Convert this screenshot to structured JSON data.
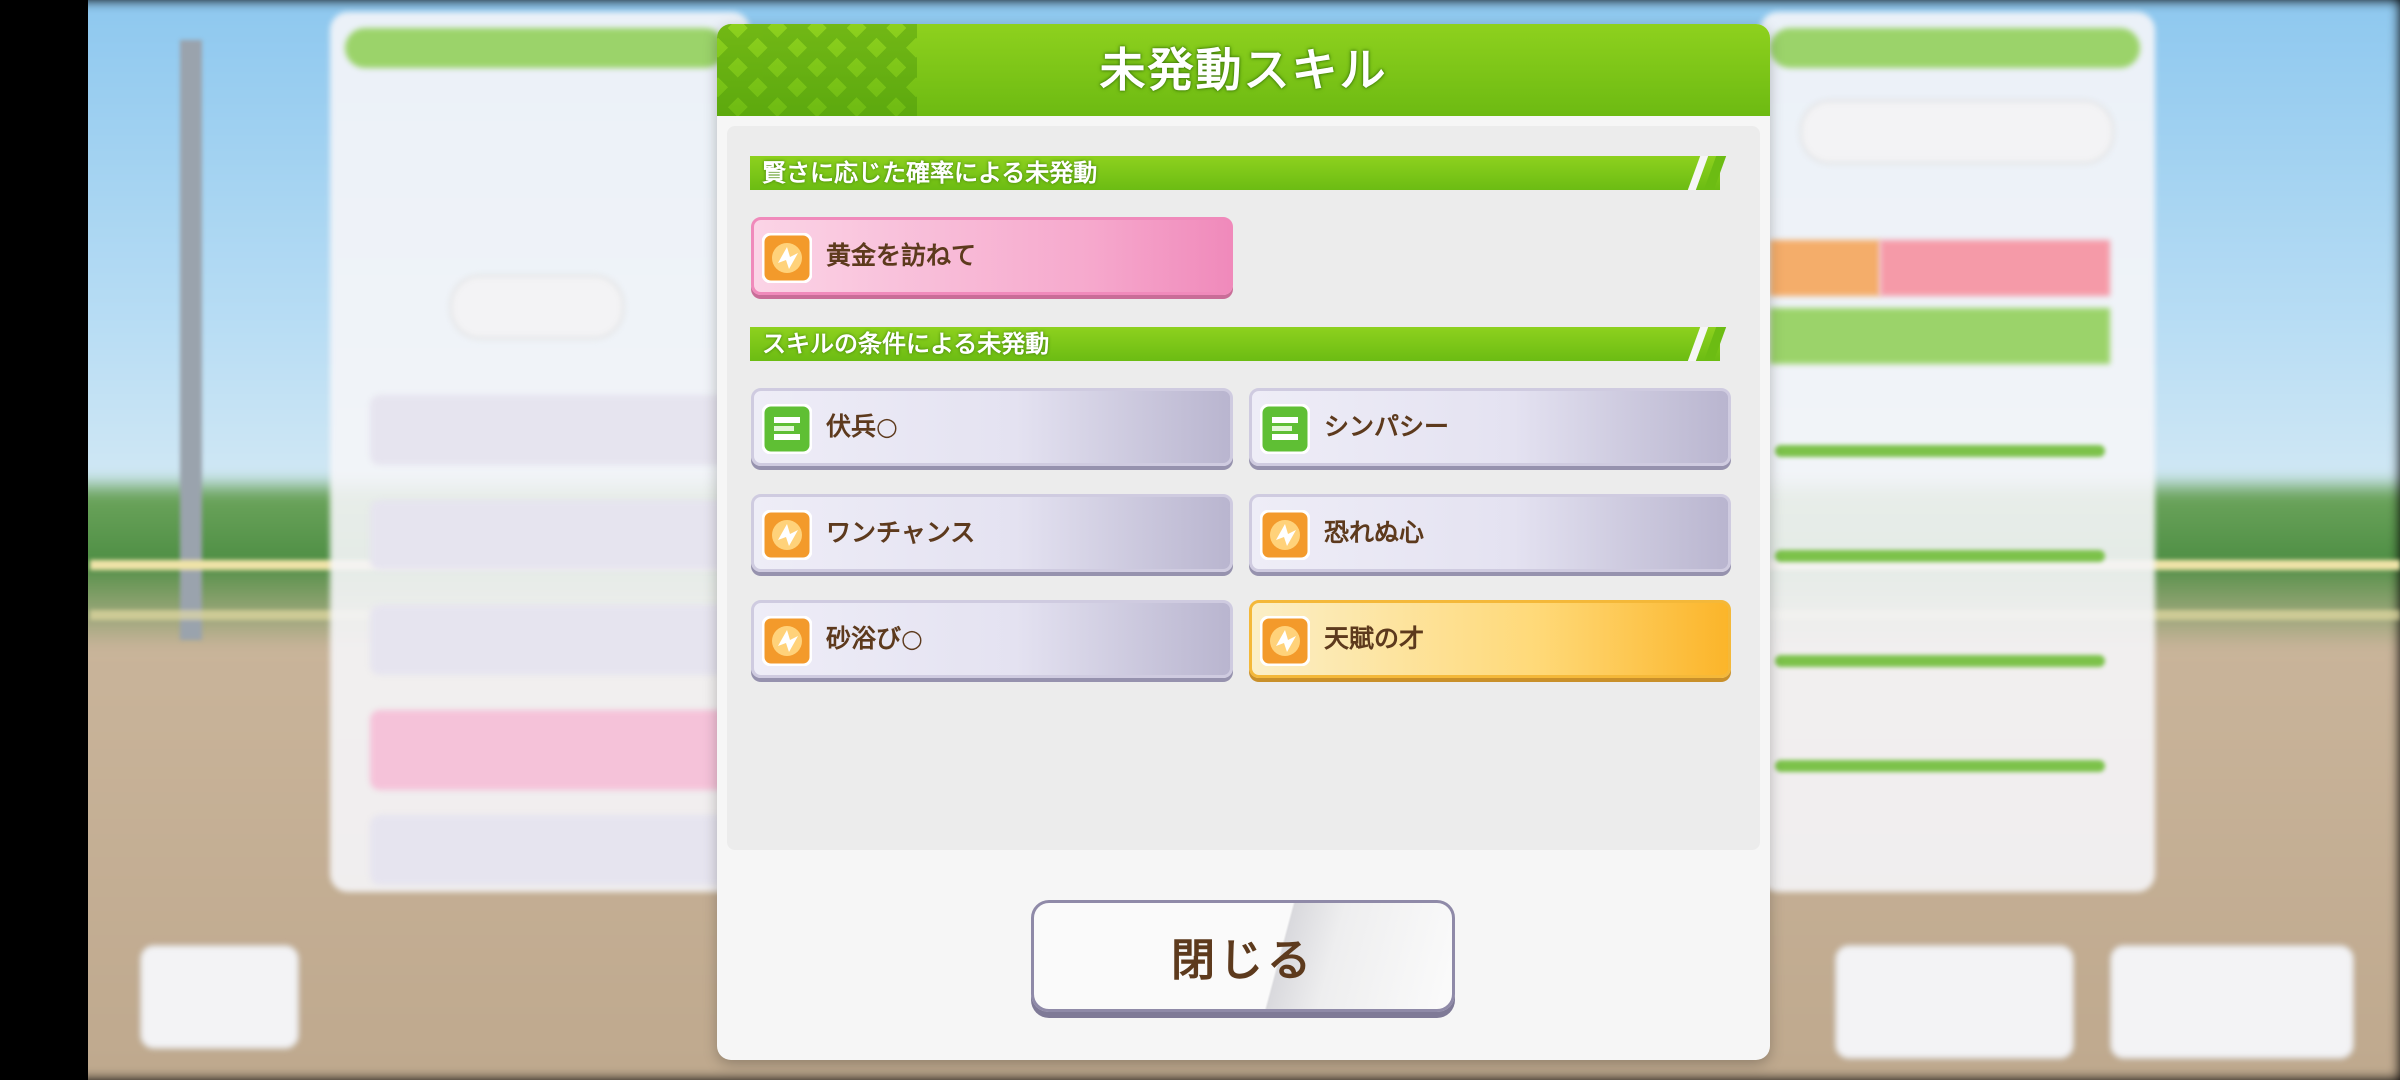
{
  "dialog": {
    "title": "未発動スキル",
    "sections": [
      {
        "label": "賢さに応じた確率による未発動",
        "skills": [
          {
            "name": "黄金を訪ねて",
            "icon": "speed-burst-icon",
            "style": "pink"
          }
        ]
      },
      {
        "label": "スキルの条件による未発動",
        "skills": [
          {
            "name": "伏兵○",
            "icon": "green-card-icon",
            "style": "normal"
          },
          {
            "name": "シンパシー",
            "icon": "green-card-icon",
            "style": "normal"
          },
          {
            "name": "ワンチャンス",
            "icon": "speed-burst-icon",
            "style": "normal"
          },
          {
            "name": "恐れぬ心",
            "icon": "speed-burst-icon",
            "style": "normal"
          },
          {
            "name": "砂浴び○",
            "icon": "speed-burst-icon",
            "style": "normal"
          },
          {
            "name": "天賦の才",
            "icon": "speed-burst-icon",
            "style": "gold"
          }
        ]
      }
    ],
    "close_label": "閉じる"
  },
  "colors": {
    "header_green": "#7cc518",
    "skill_text": "#5d3a1d",
    "pink_skill": "#f6a9cd",
    "gold_skill": "#ffd978"
  }
}
